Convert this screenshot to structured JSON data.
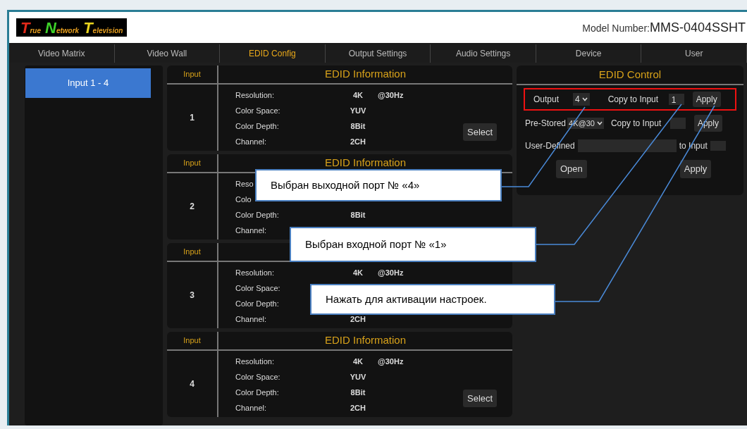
{
  "header": {
    "logo": "True Network Television",
    "model_label": "Model Number:",
    "model_value": "MMS-0404SSHT"
  },
  "nav": [
    {
      "label": "Video Matrix",
      "selected": false
    },
    {
      "label": "Video Wall",
      "selected": false
    },
    {
      "label": "EDID Config",
      "selected": true
    },
    {
      "label": "Output Settings",
      "selected": false
    },
    {
      "label": "Audio Settings",
      "selected": false
    },
    {
      "label": "Device",
      "selected": false
    },
    {
      "label": "User",
      "selected": false
    }
  ],
  "sidebar": {
    "items": [
      {
        "label": "Input 1 - 4",
        "selected": true
      }
    ]
  },
  "inputs": [
    {
      "input_header": "Input",
      "title": "EDID Information",
      "number": "1",
      "rows": [
        {
          "label": "Resolution:",
          "value": "4K",
          "extra": "@30Hz"
        },
        {
          "label": "Color Space:",
          "value": "YUV"
        },
        {
          "label": "Color Depth:",
          "value": "8Bit"
        },
        {
          "label": "Channel:",
          "value": "2CH"
        }
      ],
      "button": "Select"
    },
    {
      "input_header": "Input",
      "title": "EDID Information",
      "number": "2",
      "rows": [
        {
          "label": "Reso"
        },
        {
          "label": "Colo"
        },
        {
          "label": "Color Depth:",
          "value": "8Bit"
        },
        {
          "label": "Channel:"
        }
      ]
    },
    {
      "input_header": "Input",
      "number": "3",
      "rows": [
        {
          "label": "Resolution:",
          "value": "4K",
          "extra": "@30Hz"
        },
        {
          "label": "Color Space:"
        },
        {
          "label": "Color Depth:"
        },
        {
          "label": "Channel:",
          "value": "2CH"
        }
      ]
    },
    {
      "input_header": "Input",
      "title": "EDID Information",
      "number": "4",
      "rows": [
        {
          "label": "Resolution:",
          "value": "4K",
          "extra": "@30Hz"
        },
        {
          "label": "Color Space:",
          "value": "YUV"
        },
        {
          "label": "Color Depth:",
          "value": "8Bit"
        },
        {
          "label": "Channel:",
          "value": "2CH"
        }
      ],
      "button": "Select"
    }
  ],
  "edid_control": {
    "title": "EDID Control",
    "output_label": "Output",
    "output_value": "4",
    "copy_label": "Copy to Input",
    "copy_value": "1",
    "apply": "Apply",
    "prestored_label": "Pre-Stored",
    "prestored_value": "4K@30",
    "copy_label_2": "Copy to Input",
    "apply_2": "Apply",
    "user_defined_label": "User-Defined",
    "to_input_label": "to Input",
    "open": "Open",
    "apply_3": "Apply"
  },
  "callouts": [
    "Выбран выходной порт № «4»",
    "Выбран входной порт № «1»",
    "Нажать для активации настроек."
  ]
}
